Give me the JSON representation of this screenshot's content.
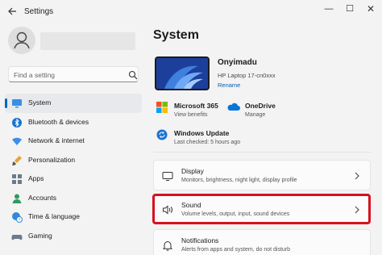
{
  "window": {
    "app_title": "Settings",
    "back_icon": "back-arrow-icon",
    "minimize_glyph": "—",
    "maximize_glyph": "☐",
    "close_glyph": "✕"
  },
  "sidebar": {
    "search_placeholder": "Find a setting",
    "items": [
      {
        "label": "System",
        "icon": "monitor-icon",
        "active": true
      },
      {
        "label": "Bluetooth & devices",
        "icon": "bluetooth-icon"
      },
      {
        "label": "Network & internet",
        "icon": "wifi-icon"
      },
      {
        "label": "Personalization",
        "icon": "brush-icon"
      },
      {
        "label": "Apps",
        "icon": "apps-icon"
      },
      {
        "label": "Accounts",
        "icon": "person-icon"
      },
      {
        "label": "Time & language",
        "icon": "globe-clock-icon"
      },
      {
        "label": "Gaming",
        "icon": "controller-icon"
      }
    ]
  },
  "main": {
    "page_title": "System",
    "device": {
      "name": "Onyimadu",
      "model": "HP Laptop 17-cn0xxx",
      "rename_label": "Rename"
    },
    "info": {
      "m365_title": "Microsoft 365",
      "m365_sub": "View benefits",
      "onedrive_title": "OneDrive",
      "onedrive_sub": "Manage",
      "update_title": "Windows Update",
      "update_sub": "Last checked: 5 hours ago"
    },
    "cards": [
      {
        "title": "Display",
        "subtitle": "Monitors, brightness, night light, display profile",
        "icon": "display-icon"
      },
      {
        "title": "Sound",
        "subtitle": "Volume levels, output, input, sound devices",
        "icon": "speaker-icon",
        "highlighted": true
      },
      {
        "title": "Notifications",
        "subtitle": "Alerts from apps and system, do not disturb",
        "icon": "bell-icon"
      }
    ]
  },
  "colors": {
    "accent": "#0067c0",
    "highlight": "#d6121f",
    "background": "#f3f3f3"
  }
}
